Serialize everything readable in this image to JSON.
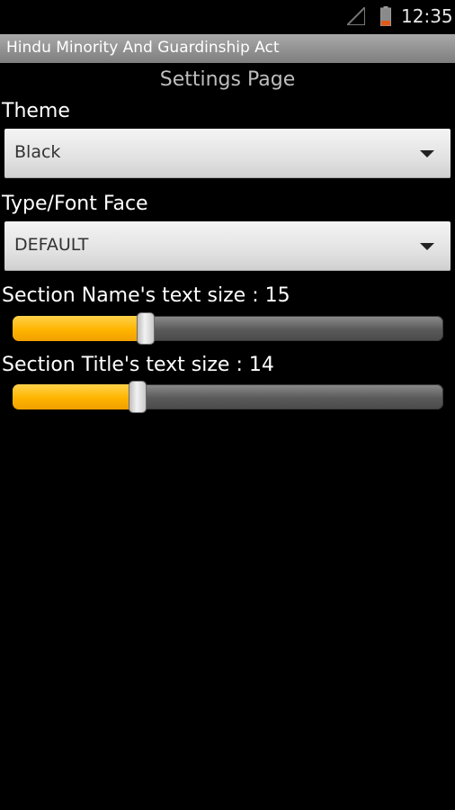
{
  "status_bar": {
    "time": "12:35",
    "icons": [
      "signal-icon",
      "battery-icon"
    ]
  },
  "app": {
    "title": "Hindu Minority And Guardinship Act"
  },
  "page": {
    "heading": "Settings Page"
  },
  "settings": {
    "theme": {
      "label": "Theme",
      "selected": "Black"
    },
    "font_face": {
      "label": "Type/Font Face",
      "selected": "DEFAULT"
    },
    "section_name_size": {
      "label": "Section Name's text size : 15",
      "value_fraction": 0.31
    },
    "section_title_size": {
      "label": "Section Title's text size : 14",
      "value_fraction": 0.29
    }
  },
  "colors": {
    "slider_fill": "#ffb400",
    "title_bar": "#8e8e8e",
    "background": "#000000"
  }
}
